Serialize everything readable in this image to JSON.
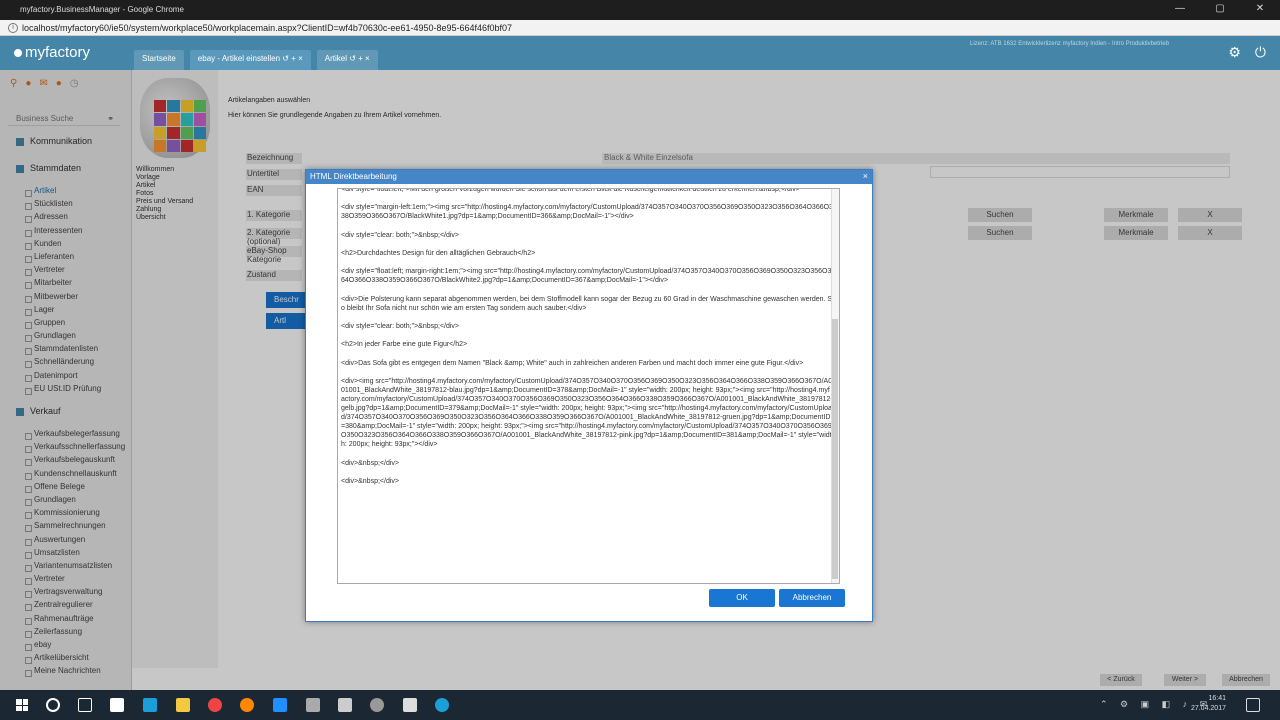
{
  "browser": {
    "title": "myfactory.BusinessManager - Google Chrome",
    "url": "localhost/myfactory60/ie50/system/workplace50/workplacemain.aspx?ClientID=wf4b70630c-ee61-4950-8e95-664f46f0bf07",
    "win_min": "—",
    "win_max": "▢",
    "win_close": "✕"
  },
  "app": {
    "logo": "myfactory",
    "license": "Lizenz: ATB 1632 Entwicklerlizenz myfactory Indien - Intro Produktivbetrieb",
    "tabs": [
      {
        "label": "Startseite"
      },
      {
        "label": "ebay - Artikel einstellen ↺ + ×"
      },
      {
        "label": "Artikel ↺ + ×"
      }
    ]
  },
  "sidebar": {
    "search_placeholder": "Business Suche",
    "sections": [
      {
        "label": "Kommunikation"
      },
      {
        "label": "Stammdaten"
      },
      {
        "label": "Verkauf"
      }
    ],
    "stammdaten_items": [
      "Artikel",
      "Stücklisten",
      "Adressen",
      "Interessenten",
      "Kunden",
      "Lieferanten",
      "Vertreter",
      "Mitarbeiter",
      "Mitbewerber",
      "Lager",
      "Gruppen",
      "Grundlagen",
      "Stammdatenlisten",
      "Schnelländerung",
      "Datenimport",
      "EU USt.ID Prüfung"
    ],
    "verkauf_items": [
      "Verkaufsbelegerfassung",
      "Verkaufsschnellerfassung",
      "Verkaufsbelegauskunft",
      "Kundenschnellauskunft",
      "Offene Belege",
      "Grundlagen",
      "Kommissionierung",
      "Sammelrechnungen",
      "Auswertungen",
      "Umsatzlisten",
      "Variantenumsatzlisten",
      "Vertreter",
      "Vertragsverwaltung",
      "Zentralregulierer",
      "Rahmenaufträge",
      "Zeilerfassung",
      "ebay",
      "Artikelübersicht",
      "Meine Nachrichten"
    ]
  },
  "subnav": {
    "links": [
      "Willkommen",
      "Vorlage",
      "Artikel",
      "Fotos",
      "Preis und Versand",
      "Zahlung",
      "Übersicht"
    ]
  },
  "main": {
    "hint1": "Artikelangaben auswählen",
    "hint2": "Hier können Sie grundlegende Angaben zu Ihrem Artikel vornehmen.",
    "labels": [
      "Bezeichnung",
      "Untertitel",
      "EAN",
      "1. Kategorie",
      "2. Kategorie (optional)",
      "eBay-Shop Kategorie",
      "Zustand"
    ],
    "bezeichnung_value": "Black & White Einzelsofa",
    "btn_suchen": "Suchen",
    "btn_merkmale": "Merkmale",
    "btn_x": "X",
    "side_btn1": "Beschr",
    "side_btn2": "Artl",
    "footer": {
      "back": "< Zurück",
      "next": "Weiter >",
      "cancel": "Abbrechen"
    }
  },
  "dialog": {
    "title": "HTML Direktbearbeitung",
    "close": "×",
    "code_lines": [
      "<div style=\"float:left;\">Mit den großen Vorzügen wurden Sie schon auf dem ersten Blick die Kuschelgemütlichkeit deutlich zu erkennen.&nbsp;</div>",
      "<div style=\"margin-left:1em;\"><img src=\"http://hosting4.myfactory.com/myfactory/CustomUpload/374O357O340O370O356O369O350O323O356O364O366O338O359O366O367O/BlackWhite1.jpg?dp=1&amp;DocumentID=366&amp;DocMail=-1\"></div>",
      "<div style=\"clear: both;\">&nbsp;</div>",
      "<h2>Durchdachtes Design für den alltäglichen Gebrauch</h2>",
      "<div style=\"float:left; margin-right:1em;\"><img src=\"http://hosting4.myfactory.com/myfactory/CustomUpload/374O357O340O370O356O369O350O323O356O364O366O338O359O366O367O/BlackWhite2.jpg?dp=1&amp;DocumentID=367&amp;DocMail=-1\"></div>",
      "<div>Die Polsterung kann separat abgenommen werden, bei dem Stoffmodell kann sogar der Bezug zu 60 Grad in der Waschmaschine gewaschen werden. So bleibt Ihr Sofa nicht nur schön wie am ersten Tag sondern auch sauber.</div>",
      "<div style=\"clear: both;\">&nbsp;</div>",
      "<h2>In jeder Farbe eine gute Figur</h2>",
      "<div>Das Sofa gibt es entgegen dem Namen \"Black &amp; White\" auch in zahlreichen anderen Farben und macht doch immer eine gute Figur.</div>",
      "<div><img src=\"http://hosting4.myfactory.com/myfactory/CustomUpload/374O357O340O370O356O369O350O323O356O364O366O338O359O366O367O/A001001_BlackAndWhite_38197812-blau.jpg?dp=1&amp;DocumentID=378&amp;DocMail=-1\" style=\"width: 200px; height: 93px;\"><img src=\"http://hosting4.myfactory.com/myfactory/CustomUpload/374O357O340O370O356O369O350O323O356O364O366O338O359O366O367O/A001001_BlackAndWhite_38197812-gelb.jpg?dp=1&amp;DocumentID=379&amp;DocMail=-1\" style=\"width: 200px; height: 93px;\"><img src=\"http://hosting4.myfactory.com/myfactory/CustomUpload/374O357O340O370O356O369O350O323O356O364O366O338O359O366O367O/A001001_BlackAndWhite_38197812-gruen.jpg?dp=1&amp;DocumentID=380&amp;DocMail=-1\" style=\"width: 200px; height: 93px;\"><img src=\"http://hosting4.myfactory.com/myfactory/CustomUpload/374O357O340O370O356O369O350O323O356O364O366O338O359O366O367O/A001001_BlackAndWhite_38197812-pink.jpg?dp=1&amp;DocumentID=381&amp;DocMail=-1\" style=\"width: 200px; height: 93px;\"></div>",
      "<div>&nbsp;</div>",
      "<div>&nbsp;</div>"
    ],
    "ok": "OK",
    "cancel": "Abbrechen"
  },
  "taskbar": {
    "time": "16:41",
    "date": "27.04.2017"
  },
  "colors": {
    "header": "#4586a8",
    "accent": "#1976d2",
    "taskbar": "#1b2733"
  }
}
